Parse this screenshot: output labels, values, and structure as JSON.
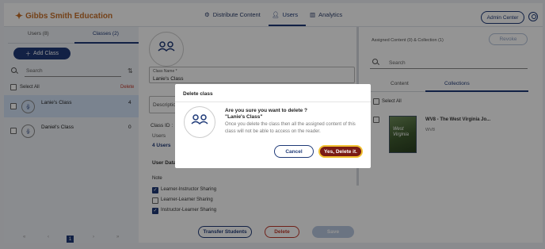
{
  "header": {
    "logo_text": "Gibbs Smith Education",
    "nav": [
      {
        "label": "Distribute Content",
        "icon": "gear-icon"
      },
      {
        "label": "Users",
        "icon": "user-icon"
      },
      {
        "label": "Analytics",
        "icon": "bar-chart-icon"
      }
    ],
    "active_nav": "Users",
    "admin_label": "Admin Center"
  },
  "left": {
    "tabs": [
      "Users (8)",
      "Classes (2)"
    ],
    "active_tab": "Classes (2)",
    "add_class_label": "Add Class",
    "search_placeholder": "Search",
    "select_all_label": "Select All",
    "delete_label": "Delete",
    "classes": [
      {
        "name": "Lanie's Class",
        "count": "4",
        "selected": true
      },
      {
        "name": "Daniel's Class",
        "count": "0",
        "selected": false
      }
    ],
    "pager": {
      "first": "«",
      "prev": "‹",
      "page": "1",
      "next": "›",
      "last": "»"
    }
  },
  "middle": {
    "class_name_label": "Class Name *",
    "class_name_value": "Lanie's Class",
    "description_placeholder": "Description",
    "class_id_label": "Class ID :",
    "users_label": "Users",
    "users_link": "4 Users",
    "user_data_label": "User Data",
    "note_label": "Note",
    "sharing": [
      {
        "label": "Learner-Instructor Sharing",
        "checked": true
      },
      {
        "label": "Learner-Learner Sharing",
        "checked": false
      },
      {
        "label": "Instructor-Learner Sharing",
        "checked": true
      }
    ],
    "transfer_label": "Transfer Students",
    "delete_label": "Delete",
    "save_label": "Save"
  },
  "right": {
    "assigned_text": "Assigned Content (0) & Collection (1)",
    "revoke_label": "Revoke",
    "search_placeholder": "Search",
    "tabs": [
      "Content",
      "Collections"
    ],
    "active_tab": "Collections",
    "select_all_label": "Select All",
    "item_title": "WV8 - The West Virginia Jo...",
    "item_sub": "WV8",
    "book_cover_text": "West Virginia"
  },
  "modal": {
    "title": "Delete class",
    "question": "Are you sure you want to delete ?",
    "class_name": "\"Lanie's Class\"",
    "message": "Once you delete the class then all the assigned content of this class will not be able to access on the reader.",
    "cancel_label": "Cancel",
    "confirm_label": "Yes, Delete it."
  },
  "colors": {
    "primary": "#1f3a78",
    "danger": "#c0392b",
    "confirm_bg": "#7a1b14",
    "confirm_border": "#f1c232",
    "selected_row": "#d3e2f7"
  }
}
